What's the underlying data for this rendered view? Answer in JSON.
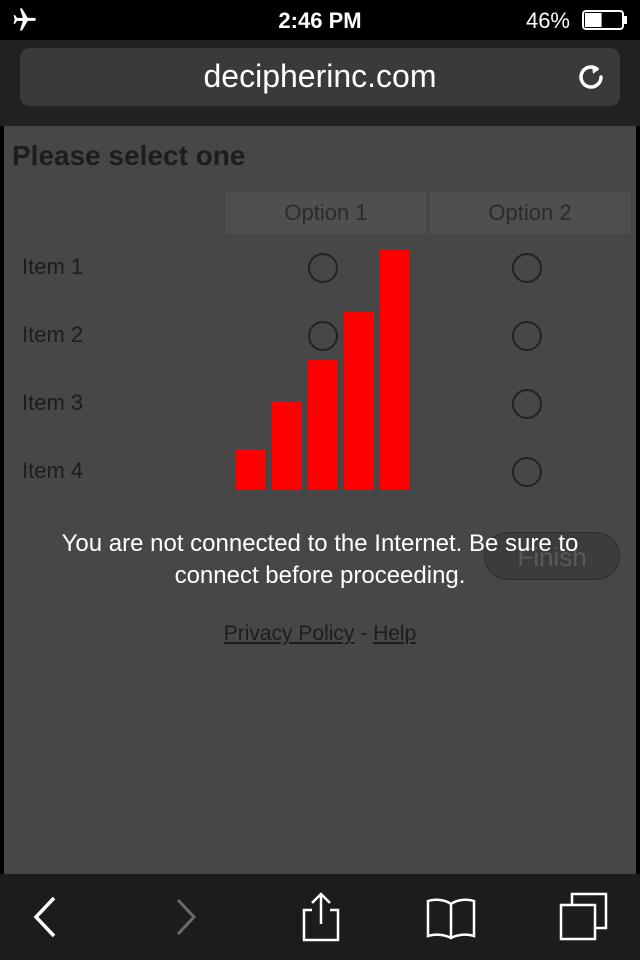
{
  "status_bar": {
    "time": "2:46 PM",
    "battery_percent": "46%",
    "battery_level": 0.46,
    "airplane_icon": "airplane-icon",
    "battery_icon": "battery-icon"
  },
  "browser": {
    "url": "decipherinc.com",
    "reload_icon": "reload-icon"
  },
  "survey": {
    "title": "Please select one",
    "columns": [
      "Option 1",
      "Option 2"
    ],
    "rows": [
      "Item 1",
      "Item 2",
      "Item 3",
      "Item 4"
    ],
    "finish_label": "Finish"
  },
  "overlay": {
    "message": "You are not connected to the Internet. Be sure to connect before proceeding.",
    "bar_color": "#ff0000",
    "bar_levels": [
      0.17,
      0.37,
      0.54,
      0.74,
      1.0
    ]
  },
  "footer": {
    "privacy_label": "Privacy Policy",
    "separator": " - ",
    "help_label": "Help"
  },
  "toolbar": {
    "icons": [
      "back-icon",
      "forward-icon",
      "share-icon",
      "bookmarks-icon",
      "tabs-icon"
    ]
  }
}
